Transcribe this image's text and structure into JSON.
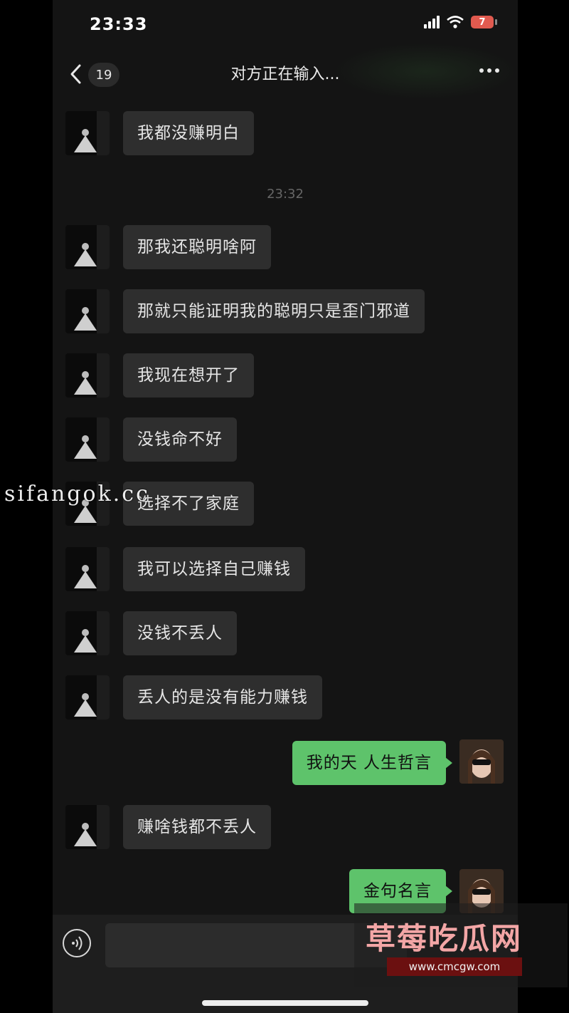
{
  "status_bar": {
    "time": "23:33",
    "battery": "7"
  },
  "nav": {
    "back_count": "19",
    "title": "对方正在输入..."
  },
  "messages": [
    {
      "text": "我都没赚明白"
    },
    {
      "timestamp": "23:32"
    },
    {
      "text": "那我还聪明啥阿"
    },
    {
      "text": "那就只能证明我的聪明只是歪门邪道"
    },
    {
      "text": "我现在想开了"
    },
    {
      "text": "没钱命不好"
    },
    {
      "text": "选择不了家庭"
    },
    {
      "text": "我可以选择自己赚钱"
    },
    {
      "text": "没钱不丢人"
    },
    {
      "text": "丢人的是没有能力赚钱"
    },
    {
      "text": "我的天 人生哲言"
    },
    {
      "text": "赚啥钱都不丢人"
    },
    {
      "text": "金句名言"
    }
  ],
  "watermarks": {
    "left": "sifangok.cc",
    "right_title": "草莓吃瓜网",
    "right_url": "www.cmcgw.com"
  },
  "colors": {
    "bubble_in": "#2e2e2e",
    "bubble_out": "#5ec36b",
    "background": "#141414"
  }
}
